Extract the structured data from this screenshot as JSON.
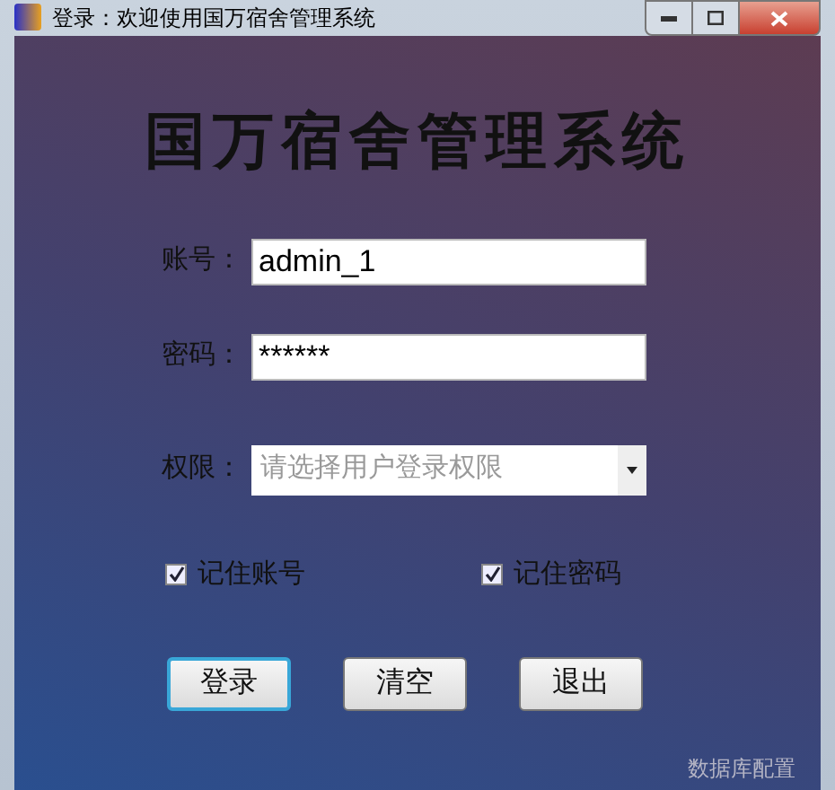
{
  "window": {
    "title": "登录：欢迎使用国万宿舍管理系统"
  },
  "heading": "国万宿舍管理系统",
  "fields": [
    {
      "label": "账号：",
      "kind": "text",
      "value": "admin_1"
    },
    {
      "label": "密码：",
      "kind": "text",
      "value": "******"
    },
    {
      "label": "权限：",
      "kind": "select",
      "placeholder": "请选择用户登录权限"
    }
  ],
  "checkboxes": [
    {
      "label": "记住账号",
      "checked": true
    },
    {
      "label": "记住密码",
      "checked": true
    }
  ],
  "buttons": [
    {
      "label": "登录",
      "focused": true
    },
    {
      "label": "清空",
      "focused": false
    },
    {
      "label": "退出",
      "focused": false
    }
  ],
  "link": "数据库配置"
}
